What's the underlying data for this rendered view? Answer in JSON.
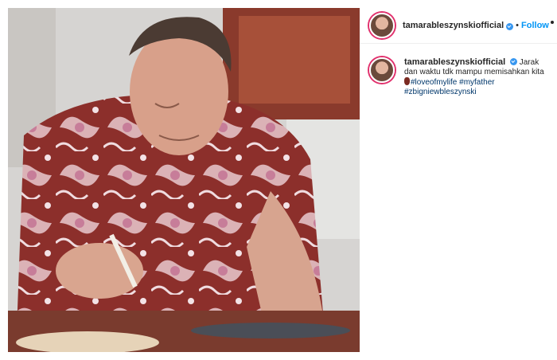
{
  "post": {
    "photo_alt": "photo",
    "author": {
      "username": "tamarableszynskiofficial",
      "verified_icon": "verified-badge-icon",
      "separator": "•",
      "follow_label": "Follow"
    },
    "caption": {
      "username": "tamarableszynskiofficial",
      "text_line1": "Jarak dan",
      "text_line2": "waktu tdk mampu memisahkan kita",
      "emoji_icon": "heart-emoji-icon",
      "hashtags": [
        "#loveofmylife",
        "#myfather",
        "#zbigniewbleszynski"
      ]
    }
  },
  "colors": {
    "accent": "#0095f6",
    "verified": "#3897f0",
    "hashtag": "#00376b"
  }
}
